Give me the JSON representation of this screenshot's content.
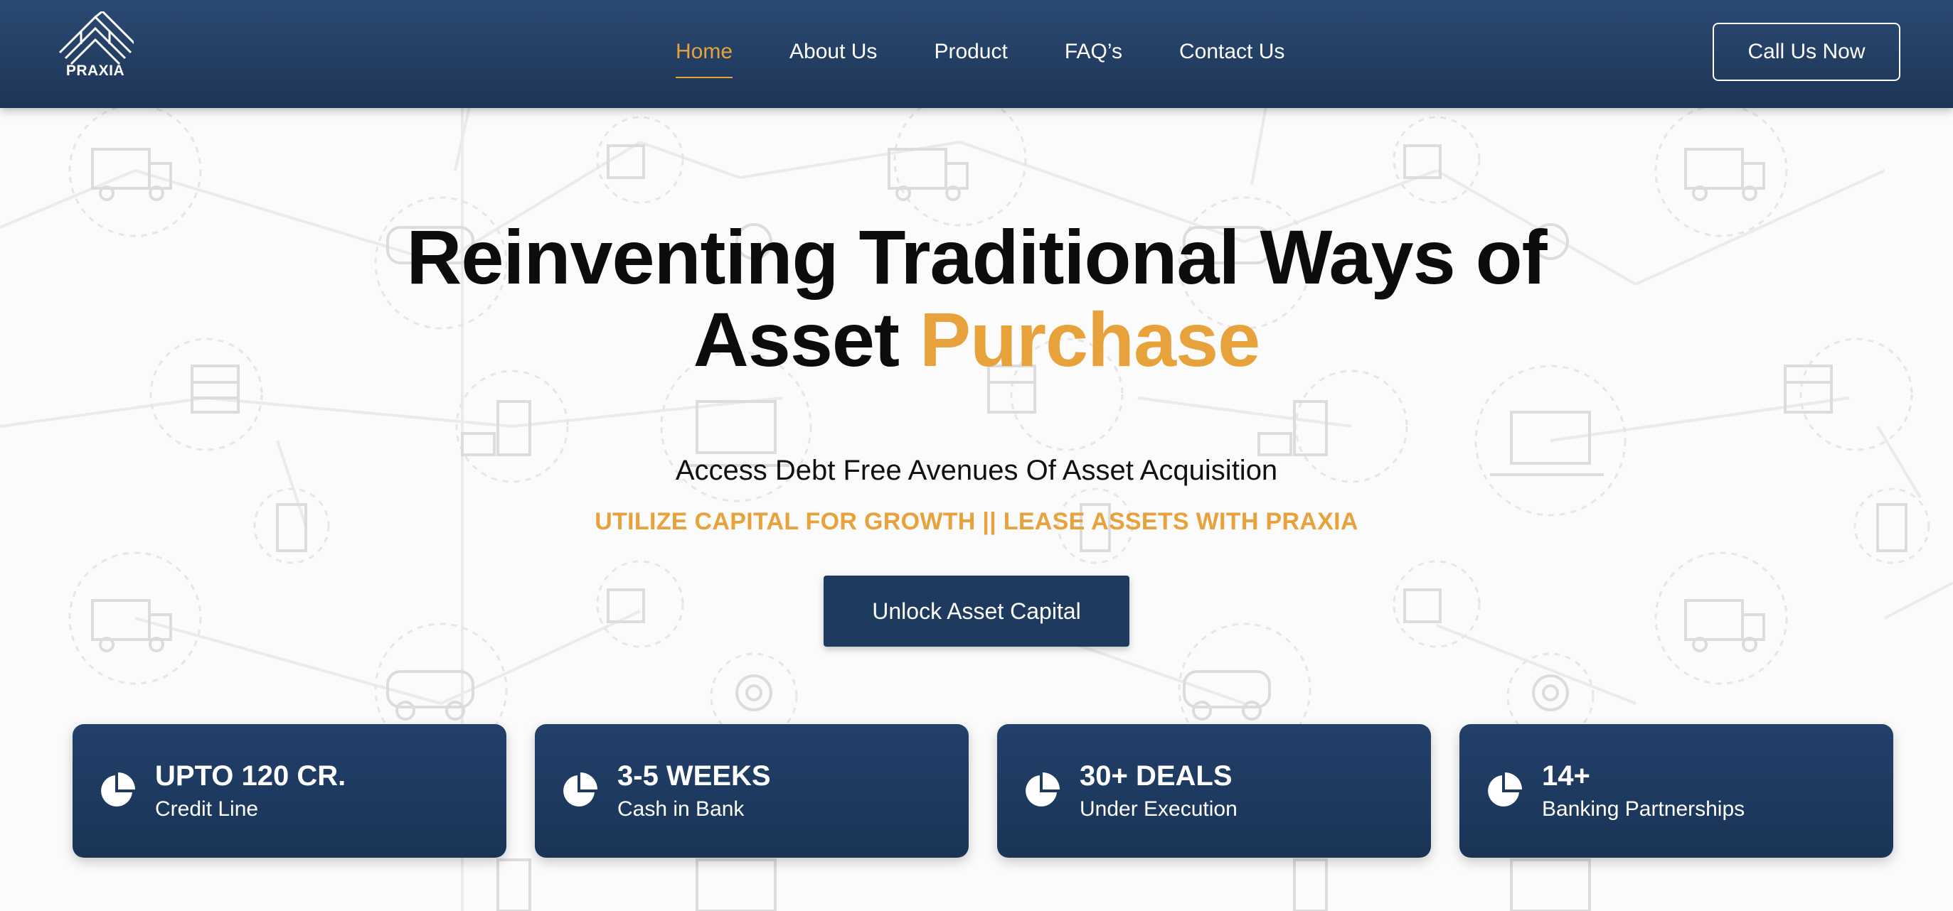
{
  "brand": {
    "name": "PRAXIA"
  },
  "nav": {
    "items": [
      {
        "label": "Home",
        "active": true
      },
      {
        "label": "About Us",
        "active": false
      },
      {
        "label": "Product",
        "active": false
      },
      {
        "label": "FAQ’s",
        "active": false
      },
      {
        "label": "Contact Us",
        "active": false
      }
    ],
    "cta_label": "Call Us Now"
  },
  "hero": {
    "title_line1": "Reinventing Traditional Ways of",
    "title_line2_plain": "Asset ",
    "title_line2_accent": "Purchase",
    "subtitle": "Access Debt Free Avenues Of Asset Acquisition",
    "tagline": "UTILIZE CAPITAL FOR GROWTH || LEASE ASSETS WITH PRAXIA",
    "button_label": "Unlock Asset Capital"
  },
  "stats": [
    {
      "value": "UPTO 120 CR.",
      "label": "Credit Line",
      "icon": "pie-chart-icon"
    },
    {
      "value": "3-5 WEEKS",
      "label": "Cash in Bank",
      "icon": "pie-chart-icon"
    },
    {
      "value": "30+ DEALS",
      "label": "Under Execution",
      "icon": "pie-chart-icon"
    },
    {
      "value": "14+",
      "label": "Banking Partnerships",
      "icon": "pie-chart-icon"
    }
  ],
  "colors": {
    "navy": "#1f3a5f",
    "accent": "#e8a23c",
    "text": "#0c0c0c"
  }
}
